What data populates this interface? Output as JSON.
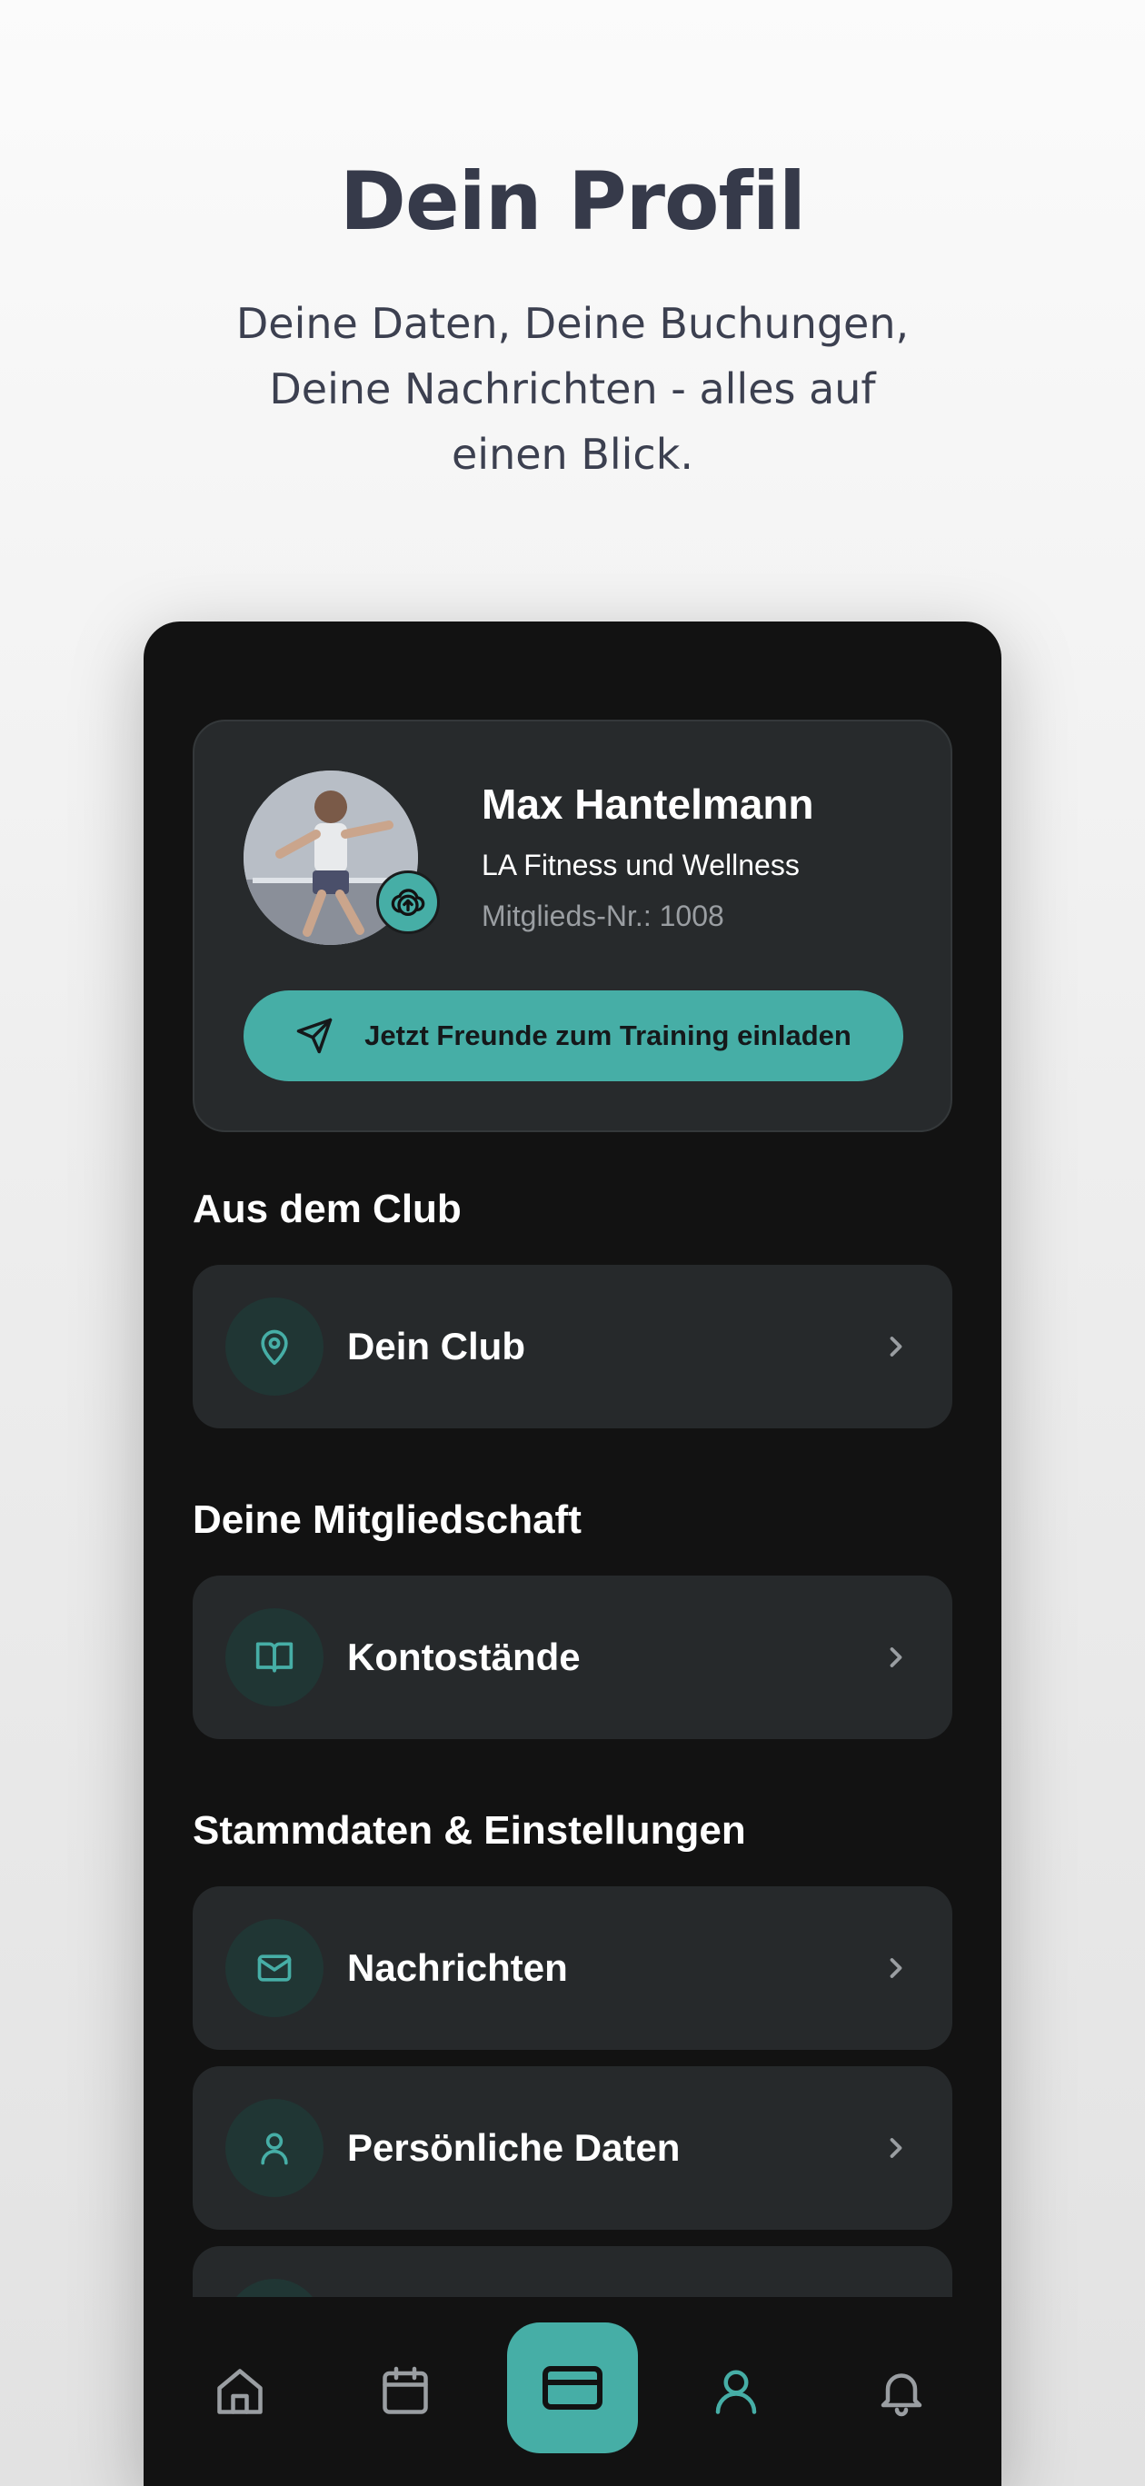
{
  "hero": {
    "title": "Dein Profil",
    "subtitle": "Deine Daten, Deine Buchungen, Deine Nachrichten - alles auf einen Blick."
  },
  "profile": {
    "name": "Max Hantelmann",
    "club": "LA Fitness und Wellness",
    "member_number": "Mitglieds-Nr.: 1008",
    "avatar_icon": "upload-cloud-icon",
    "invite_label": "Jetzt Freunde zum Training einladen",
    "invite_icon": "send-icon"
  },
  "sections": [
    {
      "title": "Aus dem Club",
      "items": [
        {
          "label": "Dein Club",
          "icon": "map-pin-icon"
        }
      ]
    },
    {
      "title": "Deine Mitgliedschaft",
      "items": [
        {
          "label": "Kontostände",
          "icon": "book-icon"
        }
      ]
    },
    {
      "title": "Stammdaten & Einstellungen",
      "items": [
        {
          "label": "Nachrichten",
          "icon": "mail-icon"
        },
        {
          "label": "Persönliche Daten",
          "icon": "user-icon"
        }
      ]
    }
  ],
  "nav": {
    "items": [
      "home-icon",
      "calendar-icon",
      "card-icon",
      "profile-icon",
      "bell-icon"
    ],
    "active": "profile-icon"
  },
  "colors": {
    "accent": "#46aea6",
    "background": "#121212",
    "card": "#26292b",
    "hero_text": "#363a4a"
  }
}
